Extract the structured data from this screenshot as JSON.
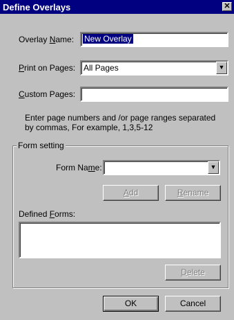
{
  "window": {
    "title": "Define Overlays",
    "close": "✕"
  },
  "overlay_name": {
    "label_pre": "Overlay ",
    "label_u": "N",
    "label_post": "ame:",
    "value": "New Overlay"
  },
  "print_on_pages": {
    "label_u": "P",
    "label_post": "rint on Pages:",
    "value": "All Pages"
  },
  "custom_pages": {
    "label_u": "C",
    "label_post": "ustom Pages:",
    "value": ""
  },
  "hint": {
    "line1": "Enter page numbers and /or page ranges separated",
    "line2": "by commas, For example, 1,3,5-12"
  },
  "form_setting": {
    "group_label": "Form setting",
    "form_name": {
      "label_pre": "Form Na",
      "label_u": "m",
      "label_post": "e:",
      "value": ""
    },
    "add_u": "A",
    "add_post": "dd",
    "rename_u": "R",
    "rename_post": "ename",
    "defined_forms": {
      "label_pre": "Defined ",
      "label_u": "F",
      "label_post": "orms:"
    },
    "delete_u": "D",
    "delete_post": "elete"
  },
  "buttons": {
    "ok": "OK",
    "cancel": "Cancel"
  },
  "icons": {
    "dropdown": "chevron-down-icon"
  }
}
